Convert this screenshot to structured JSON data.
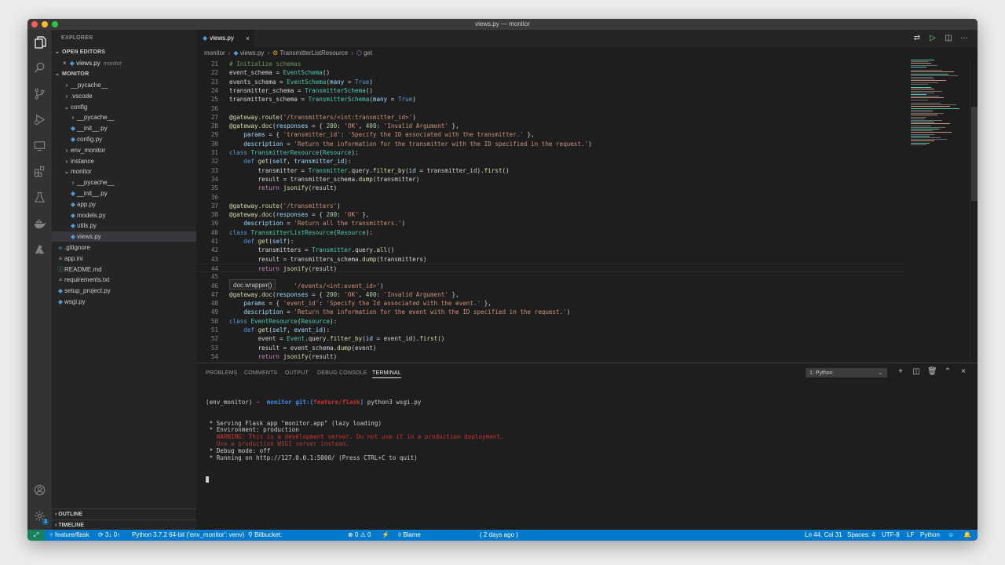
{
  "window": {
    "title": "views.py — monitor"
  },
  "sidebar": {
    "title": "EXPLORER",
    "open_editors_label": "OPEN EDITORS",
    "open_editor": {
      "close": "×",
      "file": "views.py",
      "folder": "monitor"
    },
    "project_label": "MONITOR",
    "tree": [
      {
        "label": "__pycache__",
        "kind": "folder",
        "open": false
      },
      {
        "label": ".vscode",
        "kind": "folder",
        "open": false
      },
      {
        "label": "config",
        "kind": "folder",
        "open": true
      },
      {
        "label": "__pycache__",
        "kind": "folder",
        "open": false
      },
      {
        "label": "__init__.py",
        "kind": "py"
      },
      {
        "label": "config.py",
        "kind": "py"
      },
      {
        "label": "env_monitor",
        "kind": "folder",
        "open": false
      },
      {
        "label": "instance",
        "kind": "folder",
        "open": false
      },
      {
        "label": "monitor",
        "kind": "folder",
        "open": true
      },
      {
        "label": "__pycache__",
        "kind": "folder",
        "open": false
      },
      {
        "label": "__init__.py",
        "kind": "py"
      },
      {
        "label": "app.py",
        "kind": "py"
      },
      {
        "label": "models.py",
        "kind": "py"
      },
      {
        "label": "utils.py",
        "kind": "py"
      },
      {
        "label": "views.py",
        "kind": "py",
        "selected": true
      },
      {
        "label": ".gitignore",
        "kind": "git"
      },
      {
        "label": "app.ini",
        "kind": "txt"
      },
      {
        "label": "README.md",
        "kind": "info"
      },
      {
        "label": "requirements.txt",
        "kind": "txt"
      },
      {
        "label": "setup_project.py",
        "kind": "py"
      },
      {
        "label": "wsgi.py",
        "kind": "py"
      }
    ],
    "outline_label": "OUTLINE",
    "timeline_label": "TIMELINE"
  },
  "activity_bar": {
    "icons": [
      "explorer-icon",
      "search-icon",
      "source-control-icon",
      "run-debug-icon",
      "remote-explorer-icon",
      "extensions-icon",
      "testing-icon",
      "docker-icon",
      "azure-icon"
    ],
    "accounts_icon": "account-icon",
    "settings_icon": "gear-icon",
    "settings_badge": "1"
  },
  "editor": {
    "tab": {
      "label": "views.py",
      "close": "×"
    },
    "breadcrumb": [
      "monitor",
      "views.py",
      "TransmitterListResource",
      "get"
    ],
    "hover_tip": "doc.wrapper()",
    "lines": [
      {
        "n": "21",
        "segs": [
          [
            "# Initialize schemas",
            "#6a9955"
          ]
        ]
      },
      {
        "n": "22",
        "segs": [
          [
            "event_schema = ",
            "#d4d4d4"
          ],
          [
            "EventSchema",
            "#4ec9b0"
          ],
          [
            "()",
            "#d4d4d4"
          ]
        ]
      },
      {
        "n": "23",
        "segs": [
          [
            "events_schema = ",
            "#d4d4d4"
          ],
          [
            "EventSchema",
            "#4ec9b0"
          ],
          [
            "(",
            "#d4d4d4"
          ],
          [
            "many",
            "#9cdcfe"
          ],
          [
            " = ",
            "#d4d4d4"
          ],
          [
            "True",
            "#569cd6"
          ],
          [
            ")",
            "#d4d4d4"
          ]
        ]
      },
      {
        "n": "24",
        "segs": [
          [
            "transmitter_schema = ",
            "#d4d4d4"
          ],
          [
            "TransmitterSchema",
            "#4ec9b0"
          ],
          [
            "()",
            "#d4d4d4"
          ]
        ]
      },
      {
        "n": "25",
        "segs": [
          [
            "transmitters_schema = ",
            "#d4d4d4"
          ],
          [
            "TransmitterSchema",
            "#4ec9b0"
          ],
          [
            "(",
            "#d4d4d4"
          ],
          [
            "many",
            "#9cdcfe"
          ],
          [
            " = ",
            "#d4d4d4"
          ],
          [
            "True",
            "#569cd6"
          ],
          [
            ")",
            "#d4d4d4"
          ]
        ]
      },
      {
        "n": "26",
        "segs": []
      },
      {
        "n": "27",
        "segs": [
          [
            "@gateway.route",
            "#dcdcaa"
          ],
          [
            "(",
            "#d4d4d4"
          ],
          [
            "'/transmitters/<int:transmitter_id>'",
            "#ce9178"
          ],
          [
            ")",
            "#d4d4d4"
          ]
        ]
      },
      {
        "n": "28",
        "segs": [
          [
            "@gateway.doc",
            "#dcdcaa"
          ],
          [
            "(",
            "#d4d4d4"
          ],
          [
            "responses",
            "#9cdcfe"
          ],
          [
            " = { ",
            "#d4d4d4"
          ],
          [
            "200",
            "#b5cea8"
          ],
          [
            ": ",
            "#d4d4d4"
          ],
          [
            "'OK'",
            "#ce9178"
          ],
          [
            ", ",
            "#d4d4d4"
          ],
          [
            "400",
            "#b5cea8"
          ],
          [
            ": ",
            "#d4d4d4"
          ],
          [
            "'Invalid Argument'",
            "#ce9178"
          ],
          [
            " },",
            "#d4d4d4"
          ]
        ]
      },
      {
        "n": "29",
        "segs": [
          [
            "    ",
            "#d4d4d4"
          ],
          [
            "params",
            "#9cdcfe"
          ],
          [
            " = { ",
            "#d4d4d4"
          ],
          [
            "'transmitter_id'",
            "#ce9178"
          ],
          [
            ": ",
            "#d4d4d4"
          ],
          [
            "'Specify the ID associated with the transmitter.'",
            "#ce9178"
          ],
          [
            " },",
            "#d4d4d4"
          ]
        ]
      },
      {
        "n": "30",
        "segs": [
          [
            "    ",
            "#d4d4d4"
          ],
          [
            "description",
            "#9cdcfe"
          ],
          [
            " = ",
            "#d4d4d4"
          ],
          [
            "'Return the information for the transmitter with the ID specified in the request.'",
            "#ce9178"
          ],
          [
            ")",
            "#d4d4d4"
          ]
        ]
      },
      {
        "n": "31",
        "segs": [
          [
            "class ",
            "#569cd6"
          ],
          [
            "TransmitterResource",
            "#4ec9b0"
          ],
          [
            "(",
            "#d4d4d4"
          ],
          [
            "Resource",
            "#4ec9b0"
          ],
          [
            "):",
            "#d4d4d4"
          ]
        ]
      },
      {
        "n": "32",
        "segs": [
          [
            "    ",
            "#d4d4d4"
          ],
          [
            "def ",
            "#569cd6"
          ],
          [
            "get",
            "#dcdcaa"
          ],
          [
            "(",
            "#d4d4d4"
          ],
          [
            "self",
            "#9cdcfe"
          ],
          [
            ", ",
            "#d4d4d4"
          ],
          [
            "transmitter_id",
            "#9cdcfe"
          ],
          [
            "):",
            "#d4d4d4"
          ]
        ]
      },
      {
        "n": "33",
        "segs": [
          [
            "        transmitter = ",
            "#d4d4d4"
          ],
          [
            "Transmitter",
            "#4ec9b0"
          ],
          [
            ".query.",
            "#d4d4d4"
          ],
          [
            "filter_by",
            "#dcdcaa"
          ],
          [
            "(",
            "#d4d4d4"
          ],
          [
            "id",
            "#9cdcfe"
          ],
          [
            " = transmitter_id).",
            "#d4d4d4"
          ],
          [
            "first",
            "#dcdcaa"
          ],
          [
            "()",
            "#d4d4d4"
          ]
        ]
      },
      {
        "n": "34",
        "segs": [
          [
            "        result = transmitter_schema.",
            "#d4d4d4"
          ],
          [
            "dump",
            "#dcdcaa"
          ],
          [
            "(transmitter)",
            "#d4d4d4"
          ]
        ]
      },
      {
        "n": "35",
        "segs": [
          [
            "        ",
            "#d4d4d4"
          ],
          [
            "return ",
            "#c586c0"
          ],
          [
            "jsonify",
            "#dcdcaa"
          ],
          [
            "(result)",
            "#d4d4d4"
          ]
        ]
      },
      {
        "n": "36",
        "segs": []
      },
      {
        "n": "37",
        "segs": [
          [
            "@gateway.route",
            "#dcdcaa"
          ],
          [
            "(",
            "#d4d4d4"
          ],
          [
            "'/transmitters'",
            "#ce9178"
          ],
          [
            ")",
            "#d4d4d4"
          ]
        ]
      },
      {
        "n": "38",
        "segs": [
          [
            "@gateway.doc",
            "#dcdcaa"
          ],
          [
            "(",
            "#d4d4d4"
          ],
          [
            "responses",
            "#9cdcfe"
          ],
          [
            " = { ",
            "#d4d4d4"
          ],
          [
            "200",
            "#b5cea8"
          ],
          [
            ": ",
            "#d4d4d4"
          ],
          [
            "'OK'",
            "#ce9178"
          ],
          [
            " },",
            "#d4d4d4"
          ]
        ]
      },
      {
        "n": "39",
        "segs": [
          [
            "    ",
            "#d4d4d4"
          ],
          [
            "description",
            "#9cdcfe"
          ],
          [
            " = ",
            "#d4d4d4"
          ],
          [
            "'Return all the transmitters.'",
            "#ce9178"
          ],
          [
            ")",
            "#d4d4d4"
          ]
        ]
      },
      {
        "n": "40",
        "segs": [
          [
            "class ",
            "#569cd6"
          ],
          [
            "TransmitterListResource",
            "#4ec9b0"
          ],
          [
            "(",
            "#d4d4d4"
          ],
          [
            "Resource",
            "#4ec9b0"
          ],
          [
            "):",
            "#d4d4d4"
          ]
        ]
      },
      {
        "n": "41",
        "segs": [
          [
            "    ",
            "#d4d4d4"
          ],
          [
            "def ",
            "#569cd6"
          ],
          [
            "get",
            "#dcdcaa"
          ],
          [
            "(",
            "#d4d4d4"
          ],
          [
            "self",
            "#9cdcfe"
          ],
          [
            "):",
            "#d4d4d4"
          ]
        ]
      },
      {
        "n": "42",
        "segs": [
          [
            "        transmitters = ",
            "#d4d4d4"
          ],
          [
            "Transmitter",
            "#4ec9b0"
          ],
          [
            ".query.",
            "#d4d4d4"
          ],
          [
            "all",
            "#dcdcaa"
          ],
          [
            "()",
            "#d4d4d4"
          ]
        ]
      },
      {
        "n": "43",
        "segs": [
          [
            "        result = transmitters_schema.",
            "#d4d4d4"
          ],
          [
            "dump",
            "#dcdcaa"
          ],
          [
            "(transmitters)",
            "#d4d4d4"
          ]
        ]
      },
      {
        "n": "44",
        "segs": [
          [
            "        ",
            "#d4d4d4"
          ],
          [
            "return ",
            "#c586c0"
          ],
          [
            "jsonify",
            "#dcdcaa"
          ],
          [
            "(result)",
            "#d4d4d4"
          ]
        ],
        "current": true
      },
      {
        "n": "45",
        "segs": []
      },
      {
        "n": "46",
        "segs": [
          [
            "                  ",
            "#d4d4d4"
          ],
          [
            "'/events/<int:event_id>'",
            "#ce9178"
          ],
          [
            ")",
            "#d4d4d4"
          ]
        ]
      },
      {
        "n": "47",
        "segs": [
          [
            "@gateway.doc",
            "#dcdcaa"
          ],
          [
            "(",
            "#d4d4d4"
          ],
          [
            "responses",
            "#9cdcfe"
          ],
          [
            " = { ",
            "#d4d4d4"
          ],
          [
            "200",
            "#b5cea8"
          ],
          [
            ": ",
            "#d4d4d4"
          ],
          [
            "'OK'",
            "#ce9178"
          ],
          [
            ", ",
            "#d4d4d4"
          ],
          [
            "400",
            "#b5cea8"
          ],
          [
            ": ",
            "#d4d4d4"
          ],
          [
            "'Invalid Argument'",
            "#ce9178"
          ],
          [
            " },",
            "#d4d4d4"
          ]
        ]
      },
      {
        "n": "48",
        "segs": [
          [
            "    ",
            "#d4d4d4"
          ],
          [
            "params",
            "#9cdcfe"
          ],
          [
            " = { ",
            "#d4d4d4"
          ],
          [
            "'event_id'",
            "#ce9178"
          ],
          [
            ": ",
            "#d4d4d4"
          ],
          [
            "'Specify the Id associated with the event.'",
            "#ce9178"
          ],
          [
            " },",
            "#d4d4d4"
          ]
        ]
      },
      {
        "n": "49",
        "segs": [
          [
            "    ",
            "#d4d4d4"
          ],
          [
            "description",
            "#9cdcfe"
          ],
          [
            " = ",
            "#d4d4d4"
          ],
          [
            "'Return the information for the event with the ID specified in the request.'",
            "#ce9178"
          ],
          [
            ")",
            "#d4d4d4"
          ]
        ]
      },
      {
        "n": "50",
        "segs": [
          [
            "class ",
            "#569cd6"
          ],
          [
            "EventResource",
            "#4ec9b0"
          ],
          [
            "(",
            "#d4d4d4"
          ],
          [
            "Resource",
            "#4ec9b0"
          ],
          [
            "):",
            "#d4d4d4"
          ]
        ]
      },
      {
        "n": "51",
        "segs": [
          [
            "    ",
            "#d4d4d4"
          ],
          [
            "def ",
            "#569cd6"
          ],
          [
            "get",
            "#dcdcaa"
          ],
          [
            "(",
            "#d4d4d4"
          ],
          [
            "self",
            "#9cdcfe"
          ],
          [
            ", ",
            "#d4d4d4"
          ],
          [
            "event_id",
            "#9cdcfe"
          ],
          [
            "):",
            "#d4d4d4"
          ]
        ]
      },
      {
        "n": "52",
        "segs": [
          [
            "        event = ",
            "#d4d4d4"
          ],
          [
            "Event",
            "#4ec9b0"
          ],
          [
            ".query.",
            "#d4d4d4"
          ],
          [
            "filter_by",
            "#dcdcaa"
          ],
          [
            "(",
            "#d4d4d4"
          ],
          [
            "id",
            "#9cdcfe"
          ],
          [
            " = event_id).",
            "#d4d4d4"
          ],
          [
            "first",
            "#dcdcaa"
          ],
          [
            "()",
            "#d4d4d4"
          ]
        ]
      },
      {
        "n": "53",
        "segs": [
          [
            "        result = event_schema.",
            "#d4d4d4"
          ],
          [
            "dump",
            "#dcdcaa"
          ],
          [
            "(event)",
            "#d4d4d4"
          ]
        ]
      },
      {
        "n": "54",
        "segs": [
          [
            "        ",
            "#d4d4d4"
          ],
          [
            "return ",
            "#c586c0"
          ],
          [
            "jsonify",
            "#dcdcaa"
          ],
          [
            "(result)",
            "#d4d4d4"
          ]
        ]
      }
    ]
  },
  "panel": {
    "tabs": [
      "PROBLEMS",
      "COMMENTS",
      "OUTPUT",
      "DEBUG CONSOLE",
      "TERMINAL"
    ],
    "active_tab": "TERMINAL",
    "terminal_select": "1: Python",
    "terminal": {
      "prompt_env": "(env_monitor) ",
      "prompt_arrow": "➜  ",
      "prompt_dir": "monitor ",
      "prompt_git": "git:(",
      "prompt_branch": "feature/flask",
      "prompt_git_close": ") ",
      "prompt_cmd": "python3 wsgi.py",
      "lines": [
        {
          "text": " * Serving Flask app \"monitor.app\" (lazy loading)",
          "color": "default"
        },
        {
          "text": " * Environment: production",
          "color": "default"
        },
        {
          "text": "   WARNING: This is a development server. Do not use it in a production deployment.",
          "color": "red"
        },
        {
          "text": "   Use a production WSGI server instead.",
          "color": "dimred"
        },
        {
          "text": " * Debug mode: off",
          "color": "default"
        },
        {
          "text": " * Running on http://127.0.0.1:5000/ (Press CTRL+C to quit)",
          "color": "default"
        }
      ]
    }
  },
  "statusbar": {
    "remote": "⤢",
    "branch": "feature/flask",
    "sync": "3↓ 0↑",
    "interpreter": "Python 3.7.2 64-bit ('env_monitor': venv)",
    "bitbucket": "Bitbucket:",
    "errors": "0",
    "warnings": "0",
    "blame": "Blame",
    "blame_time": "( 2 days ago )",
    "cursor_pos": "Ln 44, Col 31",
    "spaces": "Spaces: 4",
    "encoding": "UTF-8",
    "eol": "LF",
    "language": "Python"
  },
  "colors": {
    "statusbar_bg": "#007acc",
    "remote_bg": "#16825d",
    "editor_bg": "#1e1e1e",
    "sidebar_bg": "#252526",
    "activity_bg": "#333333"
  }
}
